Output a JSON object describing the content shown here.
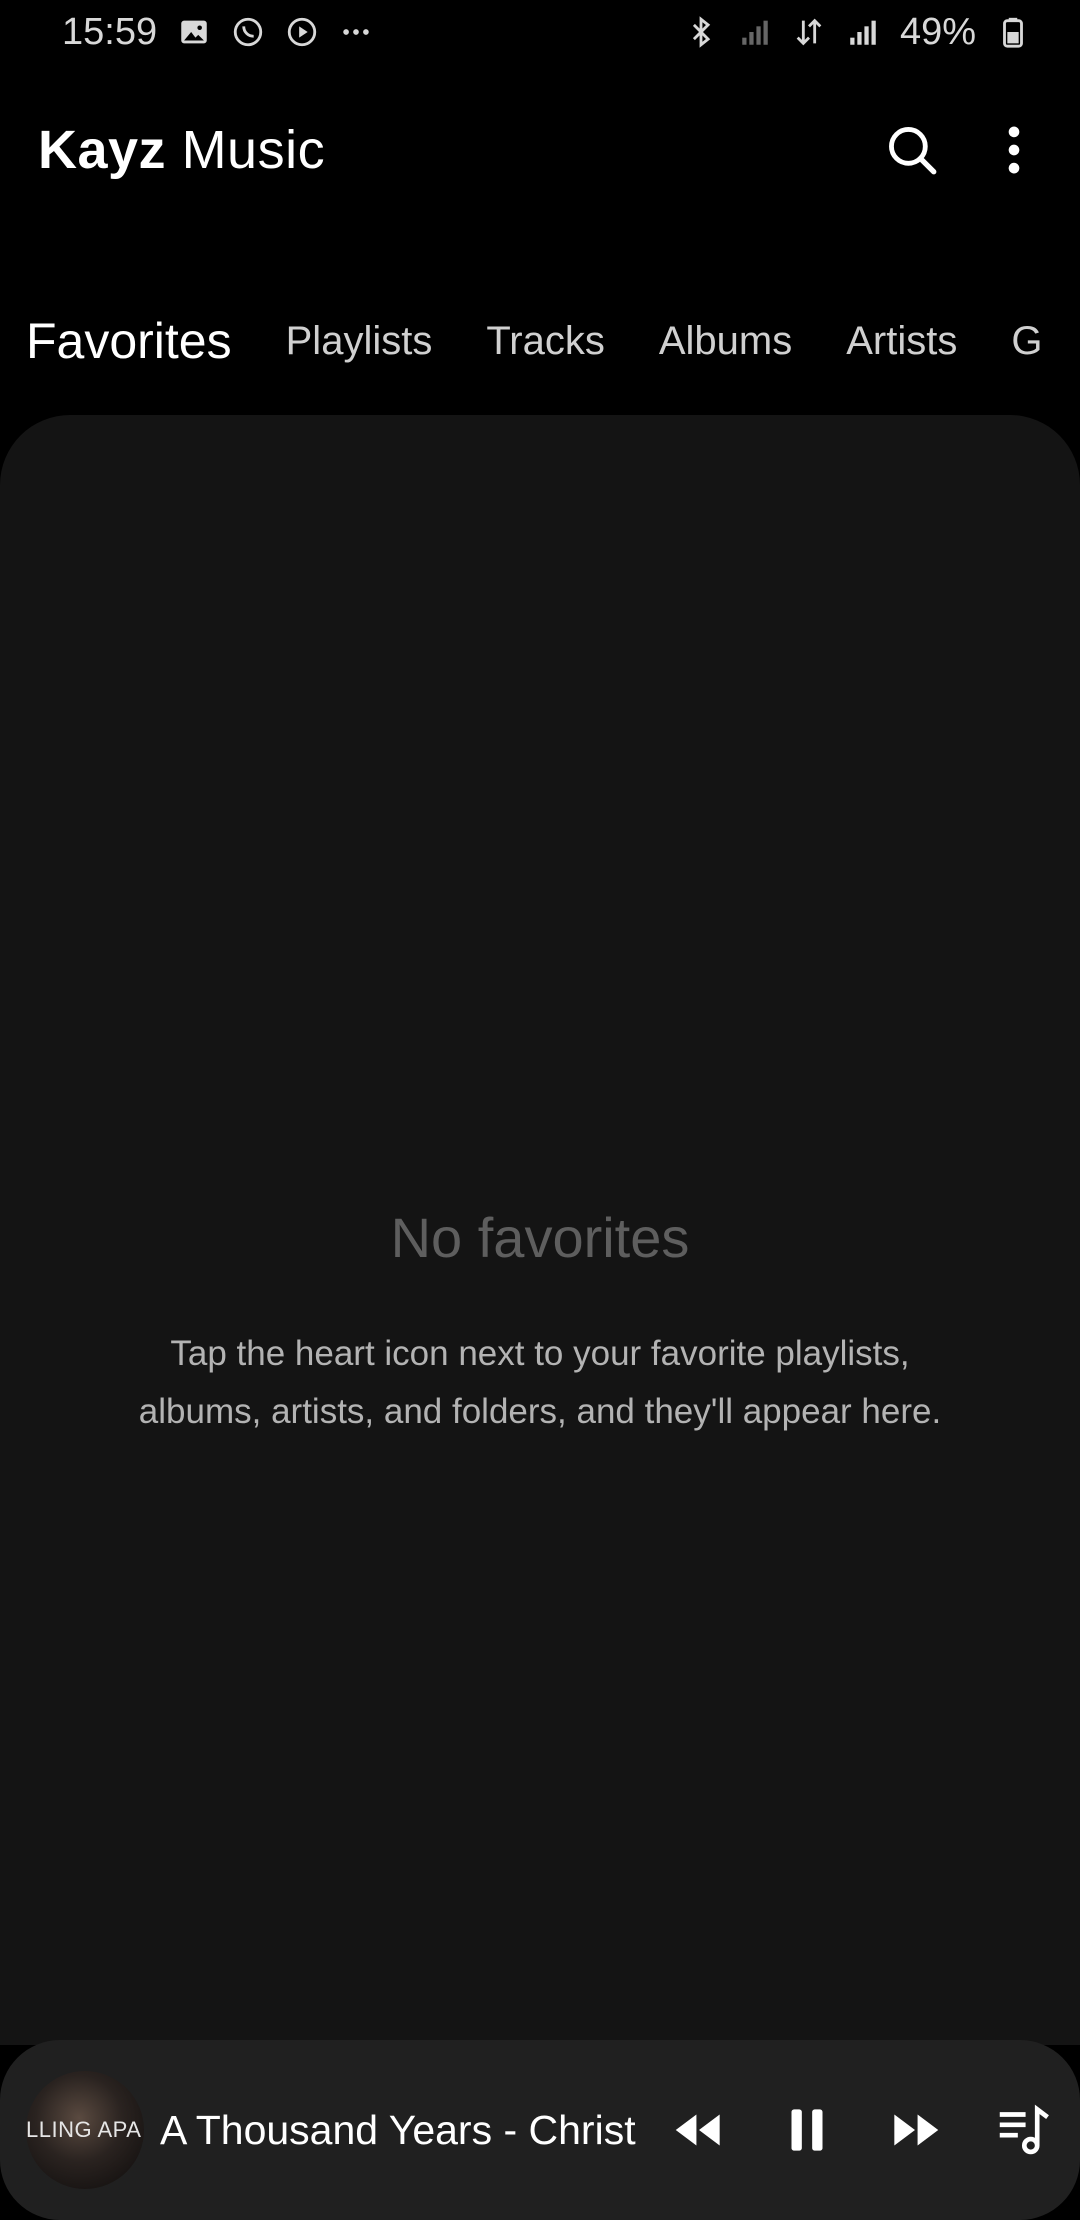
{
  "status_bar": {
    "time": "15:59",
    "battery": "49%",
    "left_icons": [
      "image-icon",
      "whatsapp-icon",
      "play-circle-icon",
      "more-dots-icon"
    ],
    "right_icons": [
      "bluetooth-icon",
      "signal-icon",
      "data-icon",
      "signal-icon",
      "battery-icon"
    ]
  },
  "app_bar": {
    "title_brand": "Kayz",
    "title_rest": " Music",
    "actions": [
      "search-icon",
      "more-vert-icon"
    ]
  },
  "tabs": [
    {
      "label": "Favorites",
      "active": true
    },
    {
      "label": "Playlists",
      "active": false
    },
    {
      "label": "Tracks",
      "active": false
    },
    {
      "label": "Albums",
      "active": false
    },
    {
      "label": "Artists",
      "active": false
    },
    {
      "label": "G",
      "active": false
    }
  ],
  "empty_state": {
    "title": "No favorites",
    "description": "Tap the heart icon next to your favorite playlists, albums, artists, and folders, and they'll appear here."
  },
  "mini_player": {
    "album_art_text": "LLING APA",
    "track_title": "A Thousand Years - Christi",
    "controls": [
      "rewind-icon",
      "pause-icon",
      "fast-forward-icon",
      "queue-music-icon"
    ]
  },
  "colors": {
    "background": "#000000",
    "panel": "#141414",
    "accent": "#6d5bd0",
    "mini_player": "#202020"
  }
}
